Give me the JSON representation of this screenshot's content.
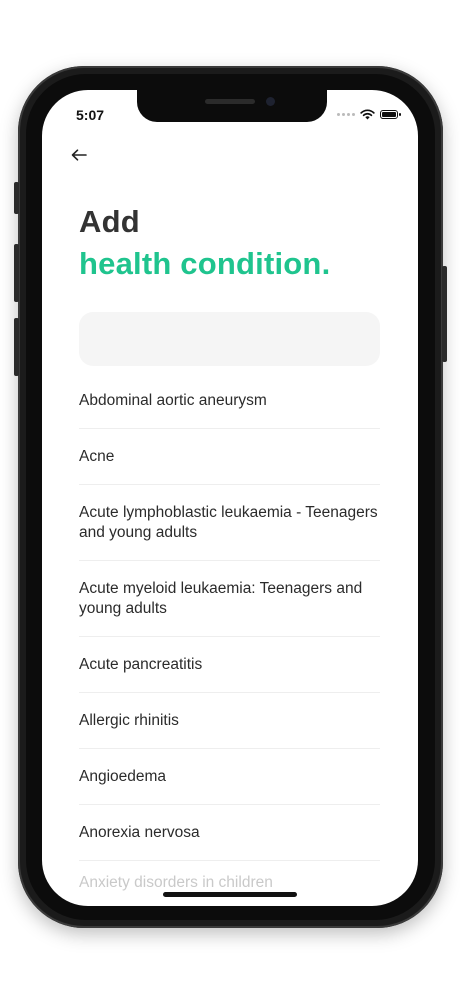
{
  "status_bar": {
    "time": "5:07"
  },
  "header": {
    "back_icon": "arrow-left-icon",
    "title_line1": "Add",
    "title_line2": "health condition."
  },
  "search": {
    "value": "",
    "placeholder": ""
  },
  "conditions": [
    {
      "label": "Abdominal aortic aneurysm"
    },
    {
      "label": "Acne"
    },
    {
      "label": "Acute lymphoblastic leukaemia - Teenagers and young adults"
    },
    {
      "label": "Acute myeloid leukaemia: Teenagers and young adults"
    },
    {
      "label": "Acute pancreatitis"
    },
    {
      "label": "Allergic rhinitis"
    },
    {
      "label": "Angioedema"
    },
    {
      "label": "Anorexia nervosa"
    },
    {
      "label": "Anxiety disorders in children"
    }
  ],
  "colors": {
    "accent": "#1fc48e",
    "title": "#333333",
    "input_bg": "#f5f5f5"
  }
}
